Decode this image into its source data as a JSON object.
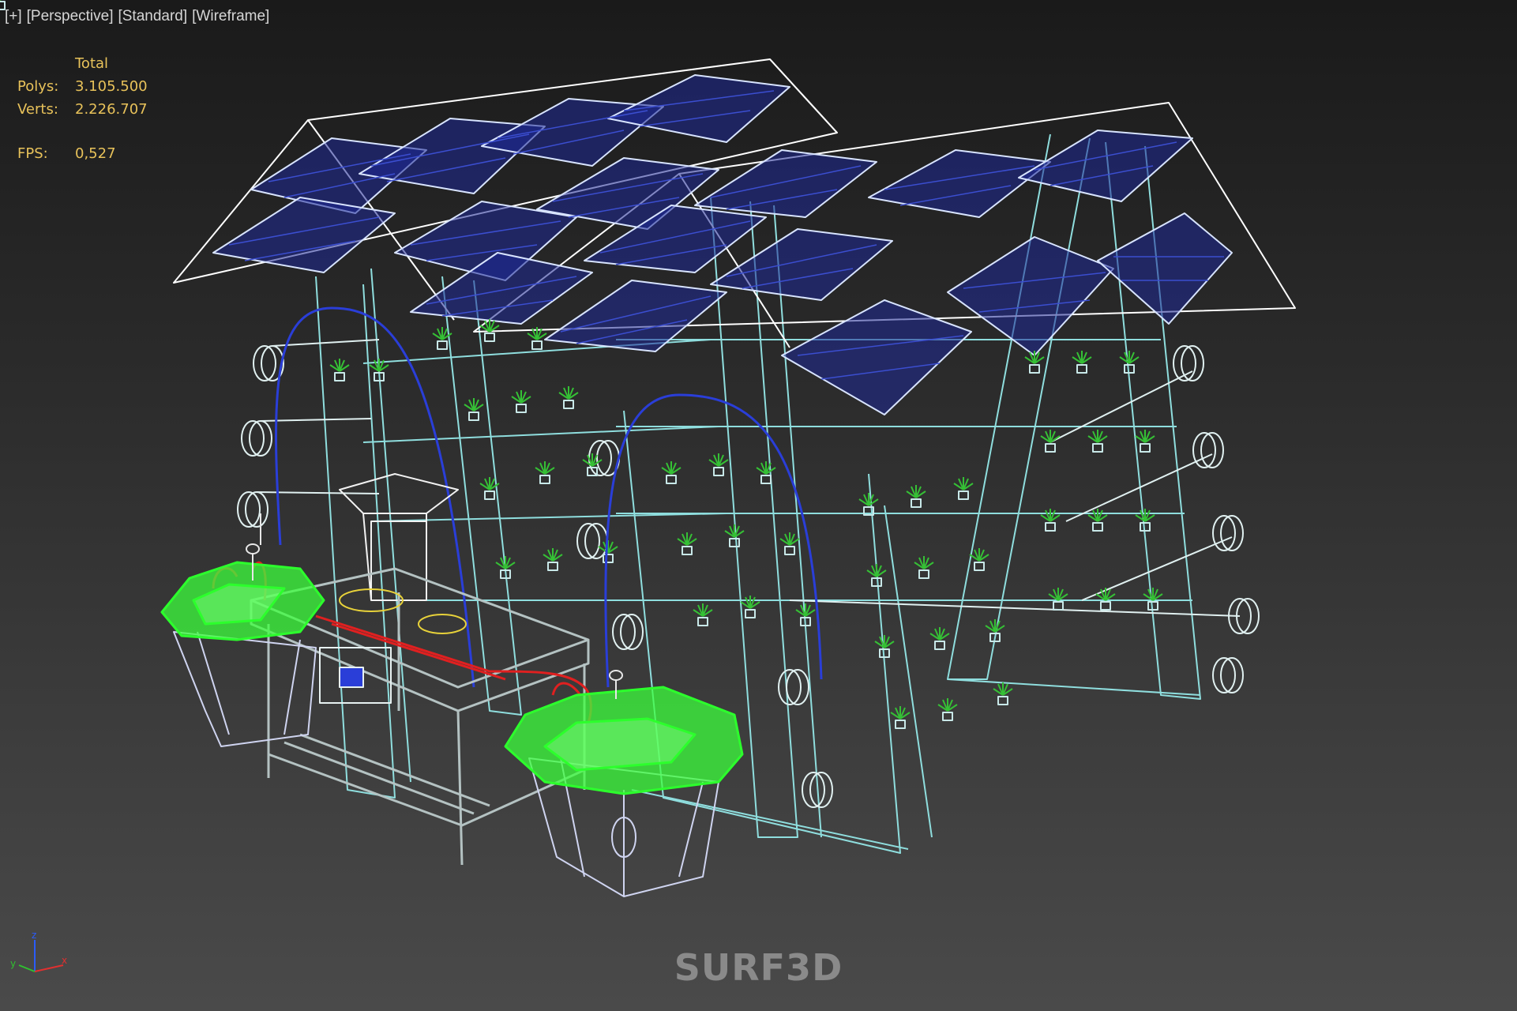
{
  "viewport_menu": {
    "plus": "[+]",
    "view": "[Perspective]",
    "shading": "[Standard]",
    "mode": "[Wireframe]"
  },
  "stats": {
    "header": "Total",
    "polys_label": "Polys:",
    "polys_value": "3.105.500",
    "verts_label": "Verts:",
    "verts_value": "2.226.707",
    "fps_label": "FPS:",
    "fps_value": "0,527"
  },
  "axis_gizmo": {
    "x": "x",
    "y": "y",
    "z": "z"
  },
  "watermark": "SURF3D",
  "colors": {
    "wire_white": "#e8f4f4",
    "wire_cyan": "#9ee8e8",
    "panel_blue": "#2a3a9a",
    "plant_green": "#2faa2f",
    "lid_green": "#3dff3d",
    "pipe_red": "#e02020",
    "table_gray": "#b8c4c4",
    "stats_yellow": "#e8c25a"
  }
}
